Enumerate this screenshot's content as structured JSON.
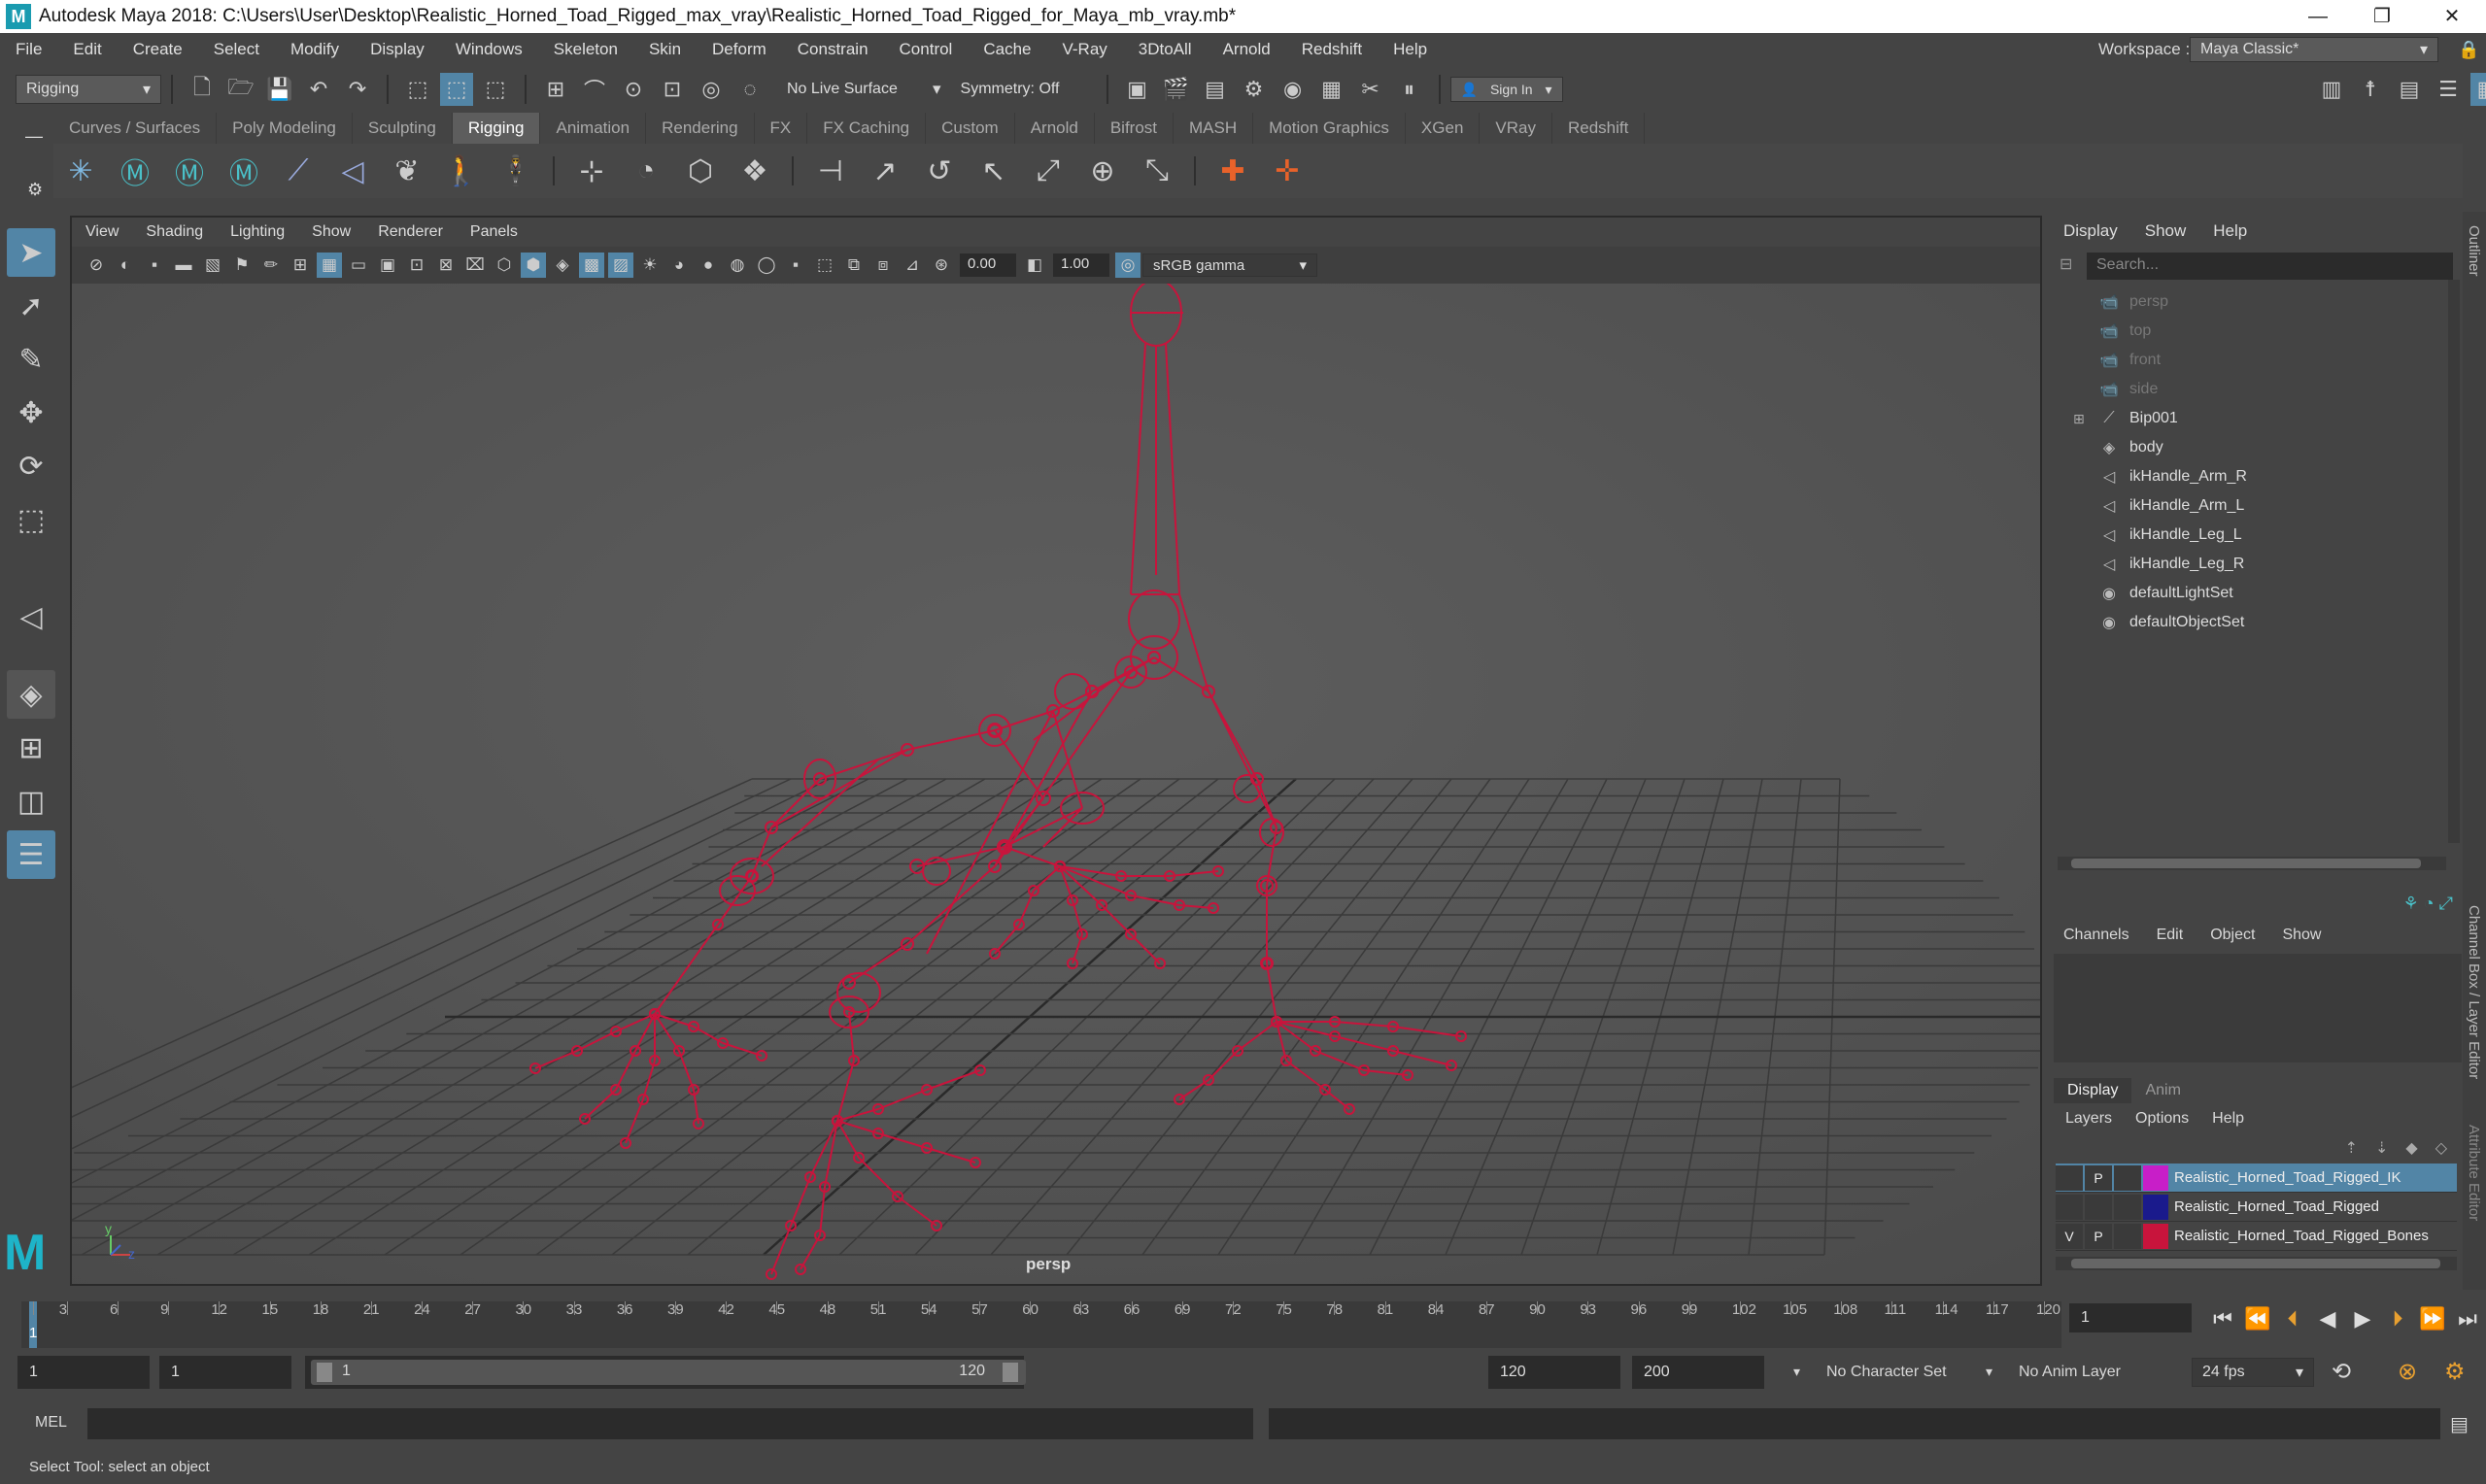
{
  "window": {
    "title": "Autodesk Maya 2018: C:\\Users\\User\\Desktop\\Realistic_Horned_Toad_Rigged_max_vray\\Realistic_Horned_Toad_Rigged_for_Maya_mb_vray.mb*",
    "minimize": "—",
    "maximize": "❐",
    "close": "✕"
  },
  "menu": [
    "File",
    "Edit",
    "Create",
    "Select",
    "Modify",
    "Display",
    "Windows",
    "Skeleton",
    "Skin",
    "Deform",
    "Constrain",
    "Control",
    "Cache",
    "V-Ray",
    "3DtoAll",
    "Arnold",
    "Redshift",
    "Help"
  ],
  "workspace": {
    "label": "Workspace :",
    "value": "Maya Classic*"
  },
  "status": {
    "menuset": "Rigging",
    "live_surface": "No Live Surface",
    "symmetry": "Symmetry: Off",
    "sign_in": "Sign In"
  },
  "shelf_tabs": [
    "Curves / Surfaces",
    "Poly Modeling",
    "Sculpting",
    "Rigging",
    "Animation",
    "Rendering",
    "FX",
    "FX Caching",
    "Custom",
    "Arnold",
    "Bifrost",
    "MASH",
    "Motion Graphics",
    "XGen",
    "VRay",
    "Redshift"
  ],
  "shelf_active": "Rigging",
  "viewport": {
    "menu": [
      "View",
      "Shading",
      "Lighting",
      "Show",
      "Renderer",
      "Panels"
    ],
    "exposure": "0.00",
    "gamma": "1.00",
    "colorspace": "sRGB gamma",
    "camera_label": "persp",
    "axis_y": "y",
    "axis_z": "z"
  },
  "outliner": {
    "menu": [
      "Display",
      "Show",
      "Help"
    ],
    "search_placeholder": "Search...",
    "items": [
      {
        "label": "persp",
        "icon": "camera-icon",
        "dim": true
      },
      {
        "label": "top",
        "icon": "camera-icon",
        "dim": true
      },
      {
        "label": "front",
        "icon": "camera-icon",
        "dim": true
      },
      {
        "label": "side",
        "icon": "camera-icon",
        "dim": true
      },
      {
        "label": "Bip001",
        "icon": "joint-icon",
        "dim": false
      },
      {
        "label": "body",
        "icon": "mesh-icon",
        "dim": false
      },
      {
        "label": "ikHandle_Arm_R",
        "icon": "ik-handle-icon",
        "dim": false
      },
      {
        "label": "ikHandle_Arm_L",
        "icon": "ik-handle-icon",
        "dim": false
      },
      {
        "label": "ikHandle_Leg_L",
        "icon": "ik-handle-icon",
        "dim": false
      },
      {
        "label": "ikHandle_Leg_R",
        "icon": "ik-handle-icon",
        "dim": false
      },
      {
        "label": "defaultLightSet",
        "icon": "set-icon",
        "dim": false
      },
      {
        "label": "defaultObjectSet",
        "icon": "set-icon",
        "dim": false
      }
    ]
  },
  "channel_box": {
    "menu": [
      "Channels",
      "Edit",
      "Object",
      "Show"
    ]
  },
  "layer_editor": {
    "tabs": [
      "Display",
      "Anim"
    ],
    "menu": [
      "Layers",
      "Options",
      "Help"
    ],
    "layers": [
      {
        "v": "",
        "p": "P",
        "color": "#c81ec8",
        "name": "Realistic_Horned_Toad_Rigged_IK",
        "selected": true
      },
      {
        "v": "",
        "p": "",
        "color": "#1a1a8c",
        "name": "Realistic_Horned_Toad_Rigged",
        "selected": false
      },
      {
        "v": "V",
        "p": "P",
        "color": "#c8143c",
        "name": "Realistic_Horned_Toad_Rigged_Bones",
        "selected": false
      }
    ]
  },
  "side_tabs": {
    "outliner": "Outliner",
    "channel": "Channel Box / Layer Editor",
    "attr": "Attribute Editor"
  },
  "timeline": {
    "ticks": [
      "1",
      "3",
      "6",
      "9",
      "12",
      "15",
      "18",
      "21",
      "24",
      "27",
      "30",
      "33",
      "36",
      "39",
      "42",
      "45",
      "48",
      "51",
      "54",
      "57",
      "60",
      "63",
      "66",
      "69",
      "72",
      "75",
      "78",
      "81",
      "84",
      "87",
      "90",
      "93",
      "96",
      "99",
      "102",
      "105",
      "108",
      "111",
      "114",
      "117",
      "120"
    ],
    "current": "1"
  },
  "range": {
    "start": "1",
    "playback_start": "1",
    "slider_start": "1",
    "slider_end": "120",
    "playback_end": "120",
    "end": "200",
    "character_set": "No Character Set",
    "anim_layer": "No Anim Layer",
    "fps": "24 fps"
  },
  "command": {
    "label": "MEL"
  },
  "help_line": "Select Tool: select an object",
  "colors": {
    "joint": "#c8143c",
    "selection": "#5285a6",
    "bg": "#444444"
  }
}
